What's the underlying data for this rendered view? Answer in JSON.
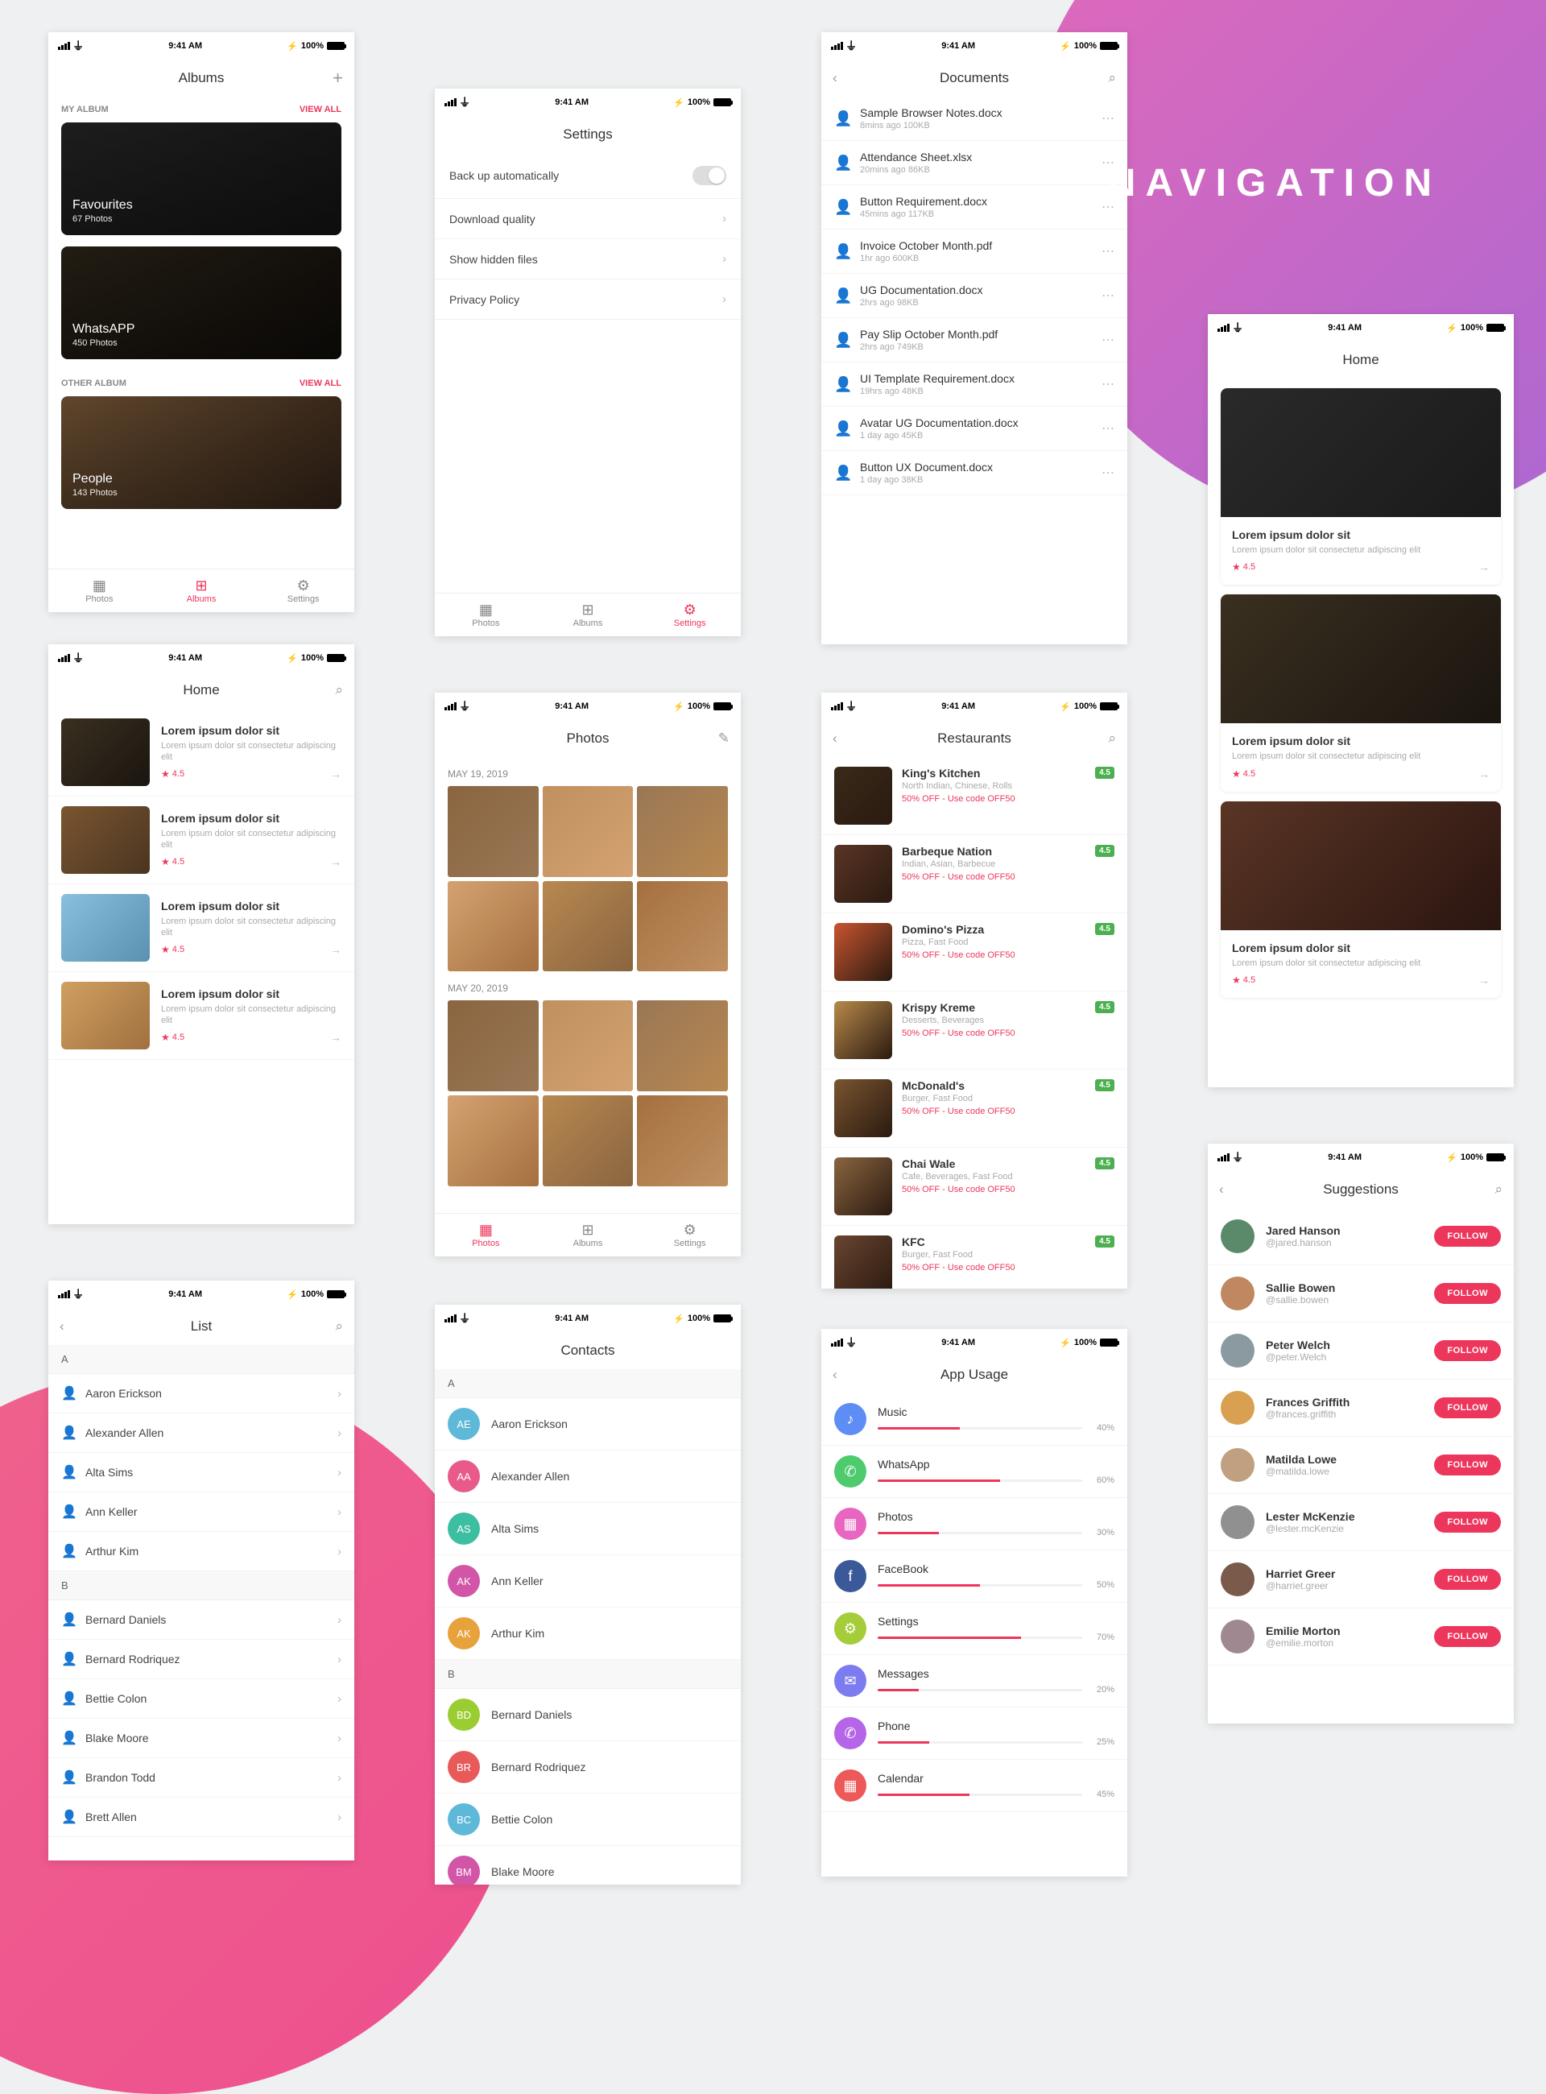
{
  "page_title": "NAVIGATION",
  "status": {
    "time": "9:41 AM",
    "battery": "100%"
  },
  "albums_screen": {
    "title": "Albums",
    "section1": "MY ALBUM",
    "view_all": "VIEW ALL",
    "fav_title": "Favourites",
    "fav_sub": "67 Photos",
    "wa_title": "WhatsAPP",
    "wa_sub": "450 Photos",
    "section2": "OTHER ALBUM",
    "people_title": "People",
    "people_sub": "143 Photos",
    "tabs": {
      "photos": "Photos",
      "albums": "Albums",
      "settings": "Settings"
    }
  },
  "settings_screen": {
    "title": "Settings",
    "r1": "Back up automatically",
    "r2": "Download  quality",
    "r3": "Show hidden files",
    "r4": "Privacy Policy"
  },
  "documents_screen": {
    "title": "Documents",
    "items": [
      {
        "title": "Sample Browser Notes.docx",
        "meta": "8mins ago    100KB"
      },
      {
        "title": "Attendance Sheet.xlsx",
        "meta": "20mins ago    86KB"
      },
      {
        "title": "Button Requirement.docx",
        "meta": "45mins ago    117KB"
      },
      {
        "title": "Invoice October Month.pdf",
        "meta": "1hr ago    600KB"
      },
      {
        "title": "UG Documentation.docx",
        "meta": "2hrs ago    98KB"
      },
      {
        "title": "Pay Slip October Month.pdf",
        "meta": "2hrs ago    749KB"
      },
      {
        "title": "UI Template Requirement.docx",
        "meta": "19hrs ago    48KB"
      },
      {
        "title": "Avatar UG Documentation.docx",
        "meta": "1 day ago    45KB"
      },
      {
        "title": "Button UX Document.docx",
        "meta": "1 day ago    38KB"
      }
    ]
  },
  "home_small": {
    "title": "Home",
    "item_title": "Lorem ipsum dolor sit",
    "item_desc": "Lorem ipsum dolor sit consectetur adipiscing elit",
    "rating": "4.5"
  },
  "photos_screen": {
    "title": "Photos",
    "date1": "MAY 19, 2019",
    "date2": "MAY 20, 2019"
  },
  "restaurants_screen": {
    "title": "Restaurants",
    "offer": "50% OFF - Use code OFF50",
    "items": [
      {
        "title": "King's Kitchen",
        "sub": "North Indian, Chinese, Rolls",
        "rating": "4.5"
      },
      {
        "title": "Barbeque Nation",
        "sub": "Indian, Asian, Barbecue",
        "rating": "4.5"
      },
      {
        "title": "Domino's Pizza",
        "sub": "Pizza, Fast Food",
        "rating": "4.5"
      },
      {
        "title": "Krispy Kreme",
        "sub": "Desserts, Beverages",
        "rating": "4.5"
      },
      {
        "title": "McDonald's",
        "sub": "Burger, Fast Food",
        "rating": "4.5"
      },
      {
        "title": "Chai Wale",
        "sub": "Cafe, Beverages, Fast Food",
        "rating": "4.5"
      },
      {
        "title": "KFC",
        "sub": "Burger, Fast Food",
        "rating": "4.5"
      }
    ]
  },
  "list_screen": {
    "title": "List",
    "sectionA": "A",
    "sectionB": "B",
    "a_items": [
      "Aaron Erickson",
      "Alexander Allen",
      "Alta Sims",
      "Ann Keller",
      "Arthur Kim"
    ],
    "b_items": [
      "Bernard Daniels",
      "Bernard Rodriquez",
      "Bettie Colon",
      "Blake Moore",
      "Brandon Todd",
      "Brett Allen"
    ]
  },
  "contacts_screen": {
    "title": "Contacts",
    "sectionA": "A",
    "sectionB": "B",
    "items": [
      {
        "initials": "AE",
        "color": "#5eb9d8",
        "name": "Aaron Erickson"
      },
      {
        "initials": "AA",
        "color": "#e85a8a",
        "name": "Alexander Allen"
      },
      {
        "initials": "AS",
        "color": "#3cbea0",
        "name": "Alta Sims"
      },
      {
        "initials": "AK",
        "color": "#d255a8",
        "name": "Ann Keller"
      },
      {
        "initials": "AK",
        "color": "#e8a23c",
        "name": "Arthur Kim"
      },
      {
        "initials": "BD",
        "color": "#9acd32",
        "name": "Bernard Daniels"
      },
      {
        "initials": "BR",
        "color": "#e85a5a",
        "name": "Bernard Rodriquez"
      },
      {
        "initials": "BC",
        "color": "#5eb9d8",
        "name": "Bettie Colon"
      },
      {
        "initials": "BM",
        "color": "#d255a8",
        "name": "Blake Moore"
      }
    ]
  },
  "usage_screen": {
    "title": "App Usage",
    "items": [
      {
        "icon": "♪",
        "color": "#5e8df5",
        "name": "Music",
        "pct": 40
      },
      {
        "icon": "✆",
        "color": "#4dcb6d",
        "name": "WhatsApp",
        "pct": 60
      },
      {
        "icon": "▦",
        "color": "#e866c2",
        "name": "Photos",
        "pct": 30
      },
      {
        "icon": "f",
        "color": "#3b5998",
        "name": "FaceBook",
        "pct": 50
      },
      {
        "icon": "⚙",
        "color": "#a4cd39",
        "name": "Settings",
        "pct": 70
      },
      {
        "icon": "✉",
        "color": "#7c7cf0",
        "name": "Messages",
        "pct": 20
      },
      {
        "icon": "✆",
        "color": "#b566e8",
        "name": "Phone",
        "pct": 25
      },
      {
        "icon": "▦",
        "color": "#ed5858",
        "name": "Calendar",
        "pct": 45
      }
    ]
  },
  "home_big": {
    "title": "Home",
    "item_title": "Lorem ipsum dolor sit",
    "item_desc": "Lorem ipsum dolor sit consectetur adipiscing elit",
    "rating": "4.5"
  },
  "suggestions_screen": {
    "title": "Suggestions",
    "follow": "FOLLOW",
    "items": [
      {
        "name": "Jared Hanson",
        "handle": "@jared.hanson"
      },
      {
        "name": "Sallie Bowen",
        "handle": "@sallie.bowen"
      },
      {
        "name": "Peter Welch",
        "handle": "@peter.Welch"
      },
      {
        "name": "Frances Griffith",
        "handle": "@frances.griffith"
      },
      {
        "name": "Matilda Lowe",
        "handle": "@matilda.lowe"
      },
      {
        "name": "Lester McKenzie",
        "handle": "@lester.mcKenzie"
      },
      {
        "name": "Harriet Greer",
        "handle": "@harriet.greer"
      },
      {
        "name": "Emilie Morton",
        "handle": "@emilie.morton"
      }
    ]
  }
}
